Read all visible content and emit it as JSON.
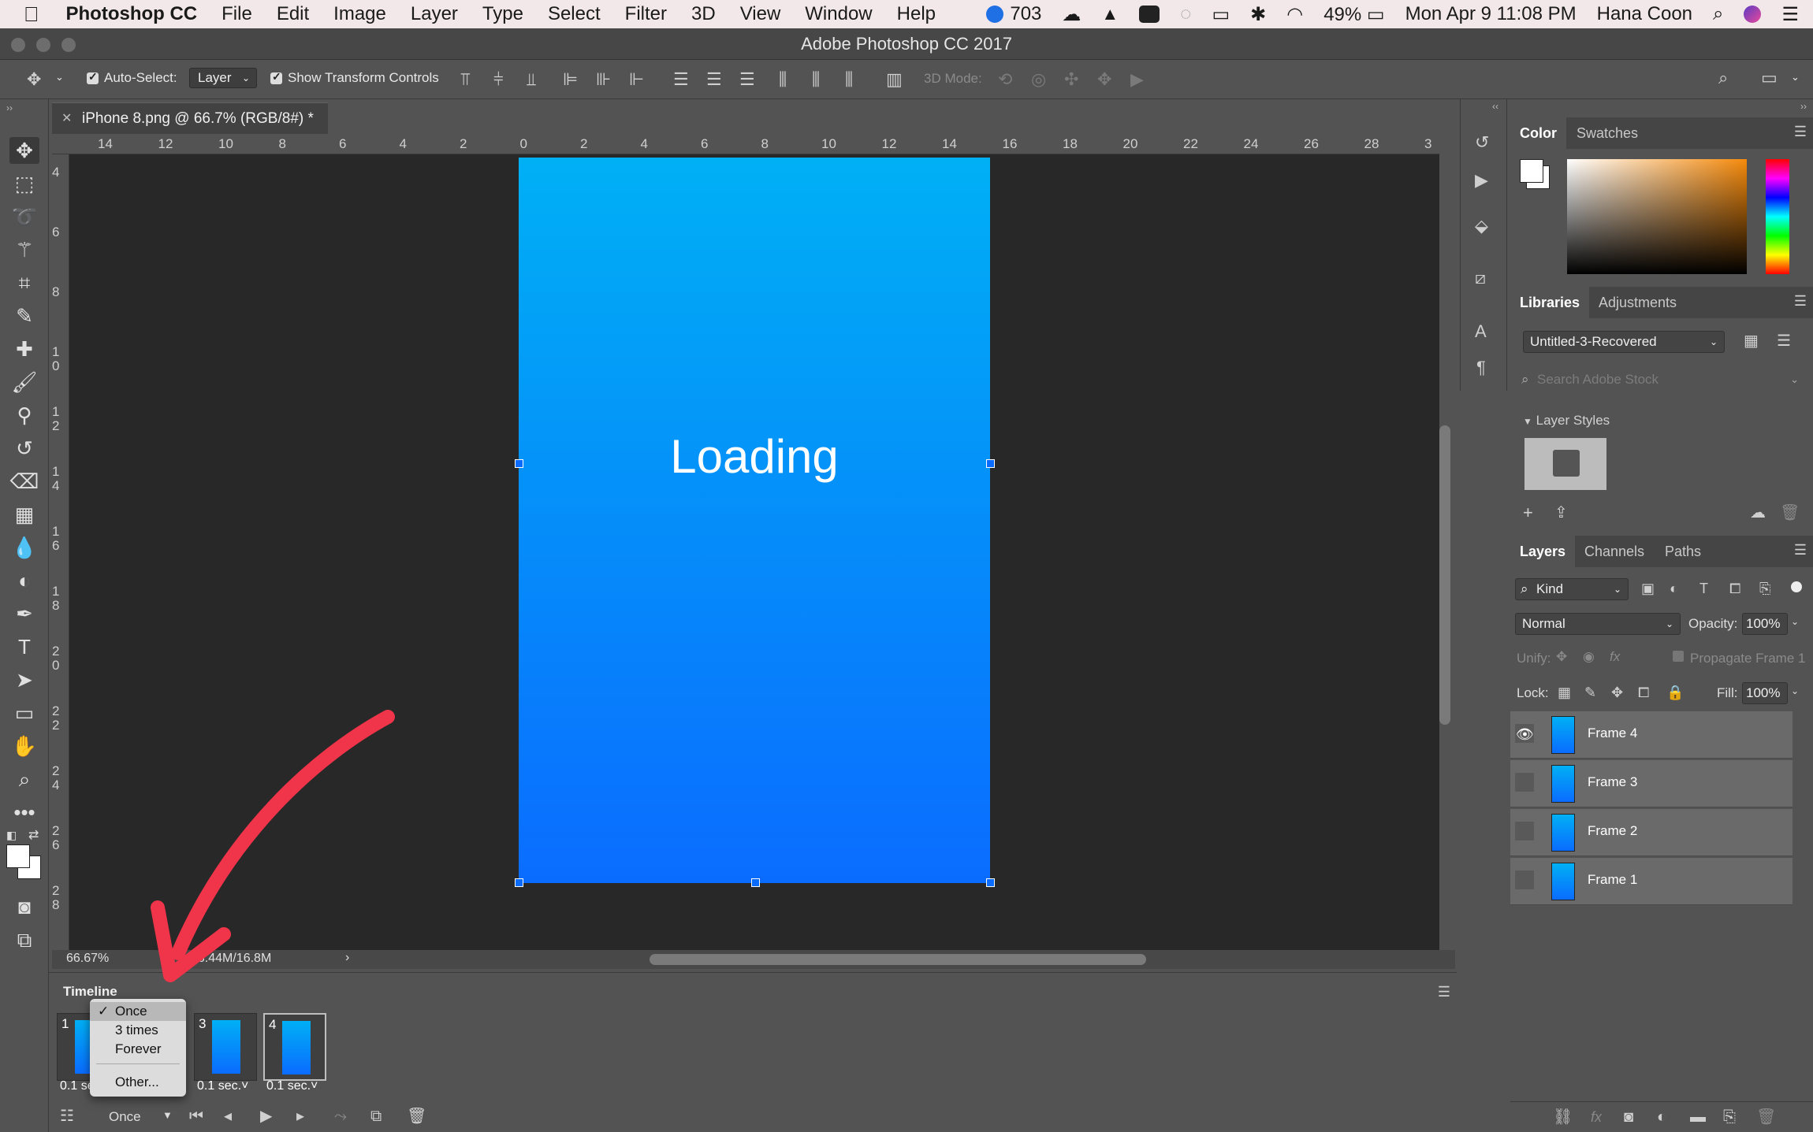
{
  "menubar": {
    "apple": "",
    "app_name": "Photoshop CC",
    "items": [
      "File",
      "Edit",
      "Image",
      "Layer",
      "Type",
      "Select",
      "Filter",
      "3D",
      "View",
      "Window",
      "Help"
    ],
    "status": {
      "badge_count": "703",
      "battery": "49%",
      "datetime": "Mon Apr 9  11:08 PM",
      "user": "Hana Coon"
    }
  },
  "window": {
    "title": "Adobe Photoshop CC 2017"
  },
  "options": {
    "auto_select_label": "Auto-Select:",
    "auto_select_value": "Layer",
    "show_transform_label": "Show Transform Controls",
    "mode_3d_label": "3D Mode:"
  },
  "document": {
    "tab_title": "iPhone 8.png @ 66.7% (RGB/8#) *",
    "canvas_text": "Loading"
  },
  "rulers": {
    "h_ticks": [
      "14",
      "12",
      "10",
      "8",
      "6",
      "4",
      "2",
      "0",
      "2",
      "4",
      "6",
      "8",
      "10",
      "12",
      "14",
      "16",
      "18",
      "20",
      "22",
      "24",
      "26",
      "28",
      "3"
    ],
    "v_ticks": [
      "4",
      "6",
      "8",
      "1\n0",
      "1\n2",
      "1\n4",
      "1\n6",
      "1\n8",
      "2\n0",
      "2\n2",
      "2\n4",
      "2\n6",
      "2\n8"
    ]
  },
  "status": {
    "zoom": "66.67%",
    "doc_info": ": 6.44M/16.8M"
  },
  "timeline": {
    "title": "Timeline",
    "frames": [
      {
        "num": "1",
        "delay": "0.1 se"
      },
      {
        "num": "3",
        "delay": "0.1 sec.˅"
      },
      {
        "num": "4",
        "delay": "0.1 sec.˅"
      }
    ],
    "loop_value": "Once",
    "loop_options": [
      "Once",
      "3 times",
      "Forever",
      "Other..."
    ]
  },
  "color_panel": {
    "tabs": [
      "Color",
      "Swatches"
    ]
  },
  "libraries_panel": {
    "tabs": [
      "Libraries",
      "Adjustments"
    ],
    "library_name": "Untitled-3-Recovered",
    "search_placeholder": "Search Adobe Stock",
    "section": "Layer Styles"
  },
  "layers_panel": {
    "tabs": [
      "Layers",
      "Channels",
      "Paths"
    ],
    "filter_kind": "Kind",
    "blend_mode": "Normal",
    "opacity_label": "Opacity:",
    "opacity_value": "100%",
    "unify_label": "Unify:",
    "propagate_label": "Propagate Frame 1",
    "lock_label": "Lock:",
    "fill_label": "Fill:",
    "fill_value": "100%",
    "layers": [
      {
        "name": "Frame 4",
        "visible": true
      },
      {
        "name": "Frame 3",
        "visible": false
      },
      {
        "name": "Frame 2",
        "visible": false
      },
      {
        "name": "Frame 1",
        "visible": false
      }
    ]
  },
  "colors": {
    "artboard_top": "#00b0f5",
    "artboard_bottom": "#0a6cff",
    "arrow": "#f0344a",
    "panel_bg": "#535353",
    "canvas_bg": "#282828"
  }
}
